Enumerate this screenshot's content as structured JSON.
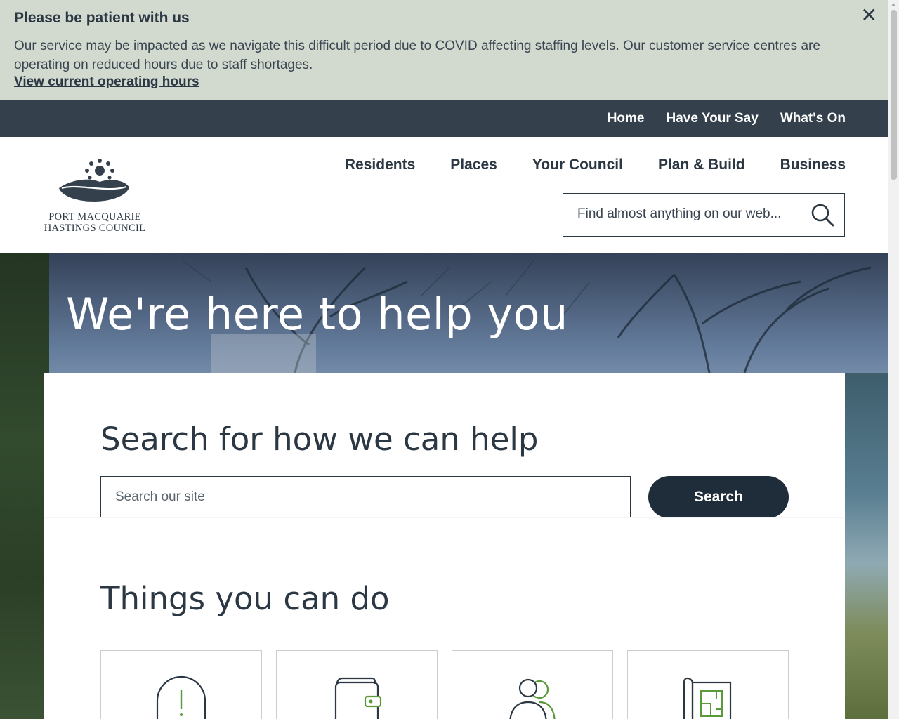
{
  "alert": {
    "title": "Please be patient with us",
    "message": "Our service may be impacted as we navigate this difficult period due to COVID affecting staffing levels. Our customer service centres are operating on reduced hours due to staff shortages.",
    "link": "View current operating hours",
    "close_icon": "close-icon"
  },
  "utility_nav": {
    "items": [
      "Home",
      "Have Your Say",
      "What's On"
    ]
  },
  "logo": {
    "line1": "PORT MACQUARIE",
    "line2": "HASTINGS COUNCIL"
  },
  "main_nav": {
    "items": [
      "Residents",
      "Places",
      "Your Council",
      "Plan & Build",
      "Business"
    ]
  },
  "header_search": {
    "placeholder": "Find almost anything on our web...",
    "icon": "search-icon"
  },
  "hero": {
    "title": "We're here to help you"
  },
  "help_search": {
    "heading": "Search for how we can help",
    "placeholder": "Search our site",
    "button": "Search"
  },
  "things": {
    "heading": "Things you can do",
    "tiles": [
      {
        "icon": "report-alert-icon"
      },
      {
        "icon": "wallet-payment-icon"
      },
      {
        "icon": "people-account-icon"
      },
      {
        "icon": "building-plan-icon"
      }
    ]
  },
  "colors": {
    "alert_bg": "#d2dad0",
    "utility_bg": "#34414d",
    "primary": "#2b3742",
    "button_bg": "#1f2d3a",
    "icon_accent": "#5a9a3a"
  }
}
